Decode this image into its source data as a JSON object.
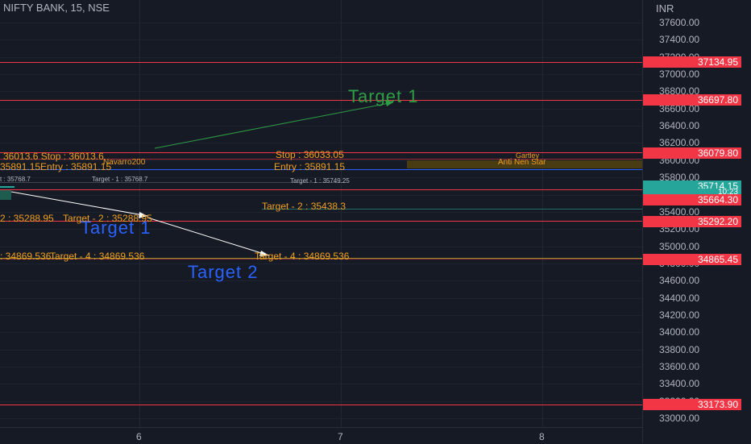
{
  "symbol": "NIFTY BANK, 15, NSE",
  "currency": "INR",
  "y_ticks": [
    "37600.00",
    "37400.00",
    "37200.00",
    "37000.00",
    "36800.00",
    "36600.00",
    "36400.00",
    "36200.00",
    "36000.00",
    "35800.00",
    "35600.00",
    "35400.00",
    "35200.00",
    "35000.00",
    "34800.00",
    "34600.00",
    "34400.00",
    "34200.00",
    "34000.00",
    "33800.00",
    "33600.00",
    "33400.00",
    "33200.00",
    "33000.00"
  ],
  "x_ticks": [
    "6",
    "7",
    "8"
  ],
  "price_labels": [
    {
      "text": "37134.95",
      "color": "#f23645"
    },
    {
      "text": "36697.80",
      "color": "#f23645"
    },
    {
      "text": "36079.80",
      "color": "#f23645"
    },
    {
      "text": "35714.15",
      "color": "#26a69a"
    },
    {
      "text": "10:23",
      "color": "#26a69a"
    },
    {
      "text": "35664.30",
      "color": "#f23645"
    },
    {
      "text": "35292.20",
      "color": "#f23645"
    },
    {
      "text": "34865.45",
      "color": "#f23645"
    },
    {
      "text": "33173.90",
      "color": "#f23645"
    }
  ],
  "annotations": {
    "target1_green": "Target 1",
    "target1_blue": "Target 1",
    "target2_blue": "Target 2",
    "stop_left": "36013.6  Stop : 36013.6",
    "stop_right": "Stop : 36033.05",
    "navarro": "Navarro200",
    "entry_left": "35891.15Entry : 35891.15",
    "entry_right": "Entry : 35891.15",
    "gartley": "Gartley",
    "anti_nen_star": "Anti Nen Star",
    "small_target_left": "Target - 1 : 35768.7",
    "small_left_partial": "t : 35768.7",
    "small_target_right": "Target - 1 : 35749.25",
    "target2_right": "Target - 2 : 35438.3",
    "target2_left": "2 : 35288.95",
    "target2_left_b": "Target - 2 : 35288.95",
    "target4_left": ": 34869.536",
    "target4_mid": "Target - 4 : 34869.536",
    "target4_right": "Target - 4 : 34869.536"
  },
  "colors": {
    "background": "#161a25",
    "red_line": "#f23645",
    "orange_text": "#f0a020",
    "green_text": "#2e9e45",
    "blue_text": "#2962ff",
    "teal": "#26a69a"
  }
}
